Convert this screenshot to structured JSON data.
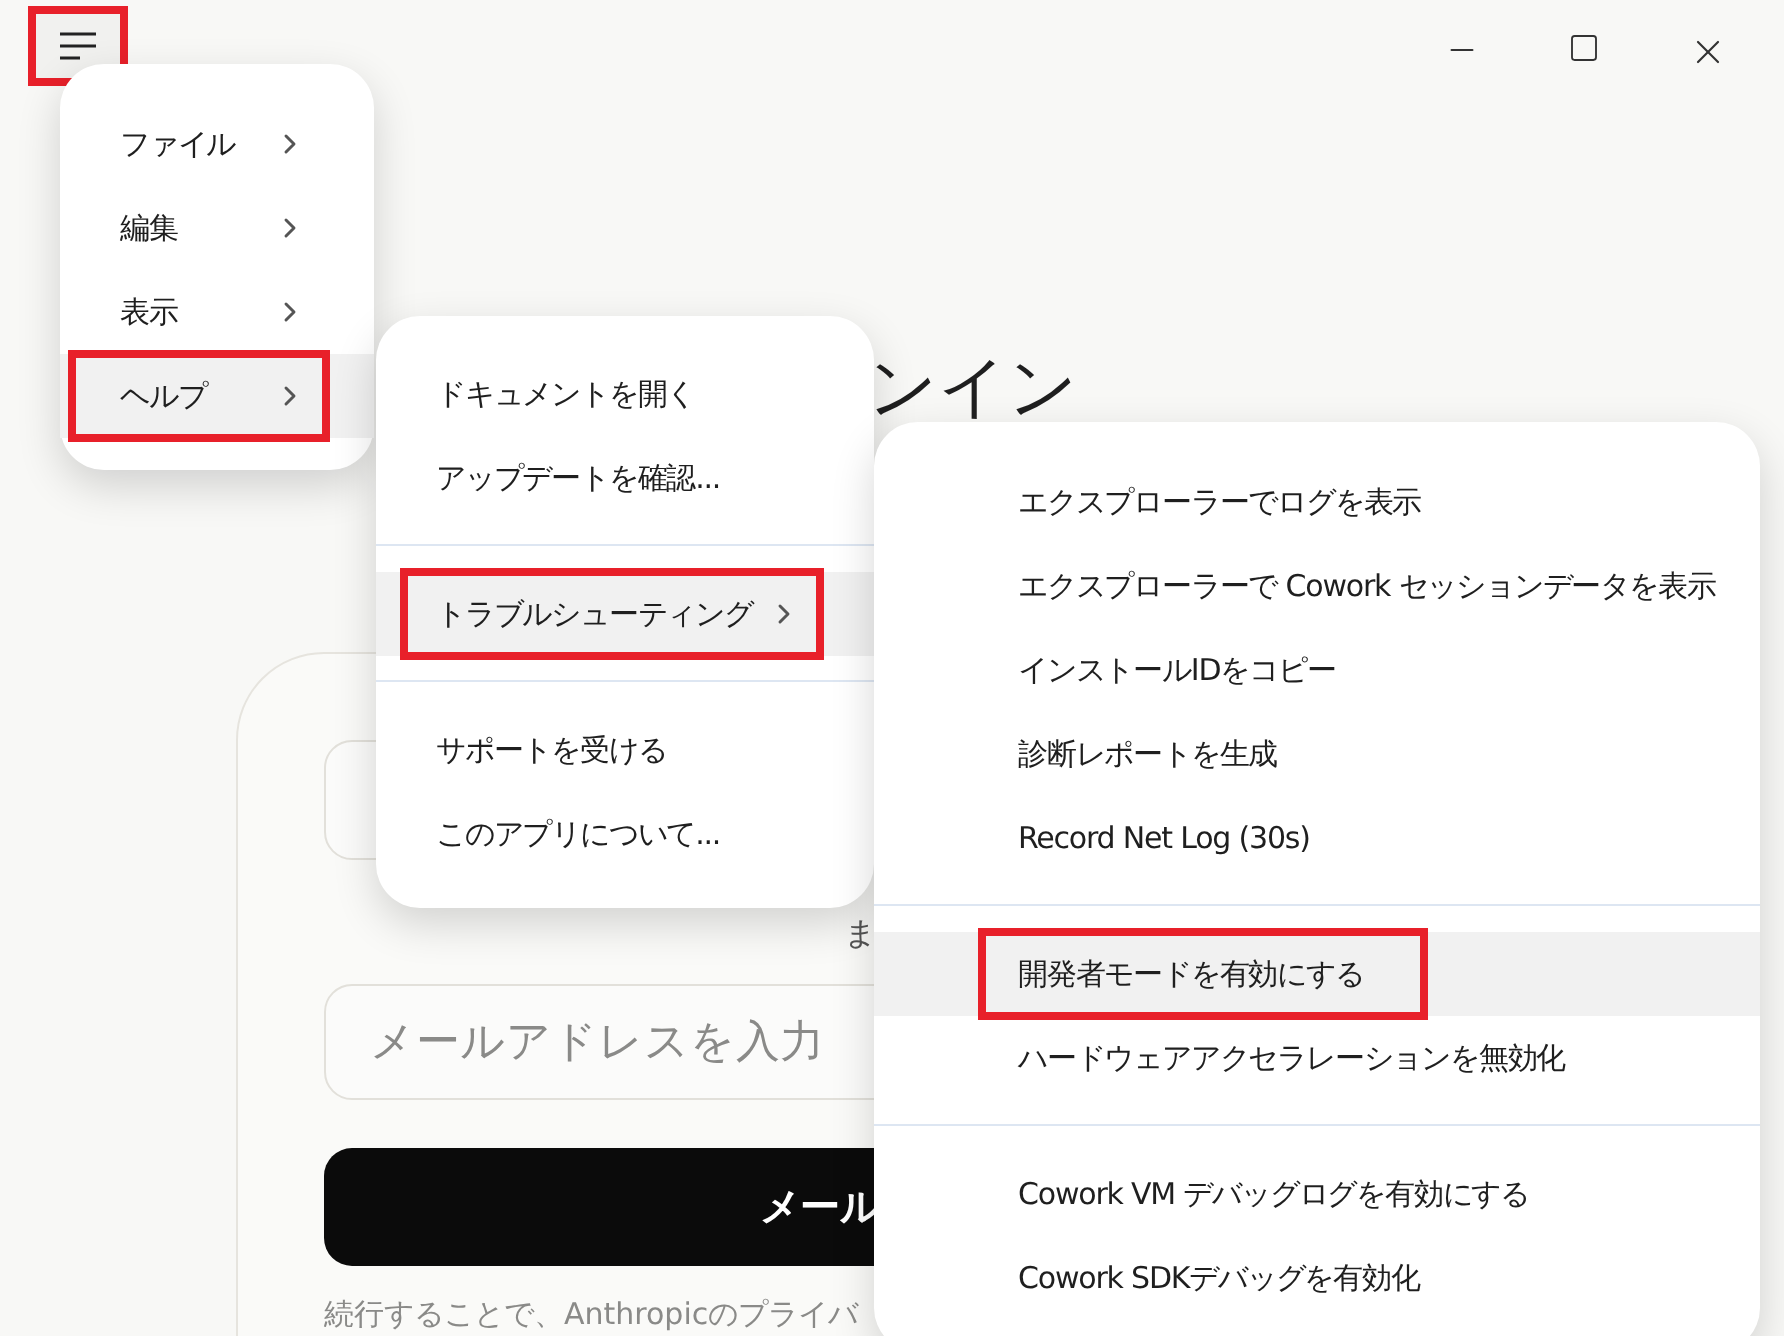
{
  "menu_button": {
    "highlighted": true
  },
  "heading": "ンイン",
  "card": {
    "note": "ま",
    "email_field": {
      "placeholder": "メールアドレスを入力"
    },
    "submit_button": "メール",
    "footer": "続行することで、Anthropicのプライバ"
  },
  "menus": [
    {
      "items": [
        {
          "kind": "item",
          "label": "ファイル",
          "has_submenu": true,
          "hovered": false,
          "highlighted": false
        },
        {
          "kind": "item",
          "label": "編集",
          "has_submenu": true,
          "hovered": false,
          "highlighted": false
        },
        {
          "kind": "item",
          "label": "表示",
          "has_submenu": true,
          "hovered": false,
          "highlighted": false
        },
        {
          "kind": "item",
          "label": "ヘルプ",
          "has_submenu": true,
          "hovered": true,
          "highlighted": true
        }
      ]
    },
    {
      "items": [
        {
          "kind": "item",
          "label": "ドキュメントを開く",
          "has_submenu": false,
          "hovered": false,
          "highlighted": false
        },
        {
          "kind": "item",
          "label": "アップデートを確認...",
          "has_submenu": false,
          "hovered": false,
          "highlighted": false
        },
        {
          "kind": "separator"
        },
        {
          "kind": "item",
          "label": "トラブルシューティング",
          "has_submenu": true,
          "hovered": true,
          "highlighted": true
        },
        {
          "kind": "separator"
        },
        {
          "kind": "item",
          "label": "サポートを受ける",
          "has_submenu": false,
          "hovered": false,
          "highlighted": false
        },
        {
          "kind": "item",
          "label": "このアプリについて...",
          "has_submenu": false,
          "hovered": false,
          "highlighted": false
        }
      ]
    },
    {
      "items": [
        {
          "kind": "item",
          "label": "エクスプローラーでログを表示",
          "has_submenu": false,
          "hovered": false,
          "highlighted": false
        },
        {
          "kind": "item",
          "label": "エクスプローラーで Cowork セッションデータを表示",
          "has_submenu": false,
          "hovered": false,
          "highlighted": false
        },
        {
          "kind": "item",
          "label": "インストールIDをコピー",
          "has_submenu": false,
          "hovered": false,
          "highlighted": false
        },
        {
          "kind": "item",
          "label": "診断レポートを生成",
          "has_submenu": false,
          "hovered": false,
          "highlighted": false
        },
        {
          "kind": "item",
          "label": "Record Net Log (30s)",
          "has_submenu": false,
          "hovered": false,
          "highlighted": false
        },
        {
          "kind": "separator"
        },
        {
          "kind": "item",
          "label": "開発者モードを有効にする",
          "has_submenu": false,
          "hovered": true,
          "highlighted": true
        },
        {
          "kind": "item",
          "label": "ハードウェアアクセラレーションを無効化",
          "has_submenu": false,
          "hovered": false,
          "highlighted": false
        },
        {
          "kind": "separator"
        },
        {
          "kind": "item",
          "label": "Cowork VM デバッグログを有効にする",
          "has_submenu": false,
          "hovered": false,
          "highlighted": false
        },
        {
          "kind": "item",
          "label": "Cowork SDKデバッグを有効化",
          "has_submenu": false,
          "hovered": false,
          "highlighted": false
        }
      ]
    }
  ]
}
